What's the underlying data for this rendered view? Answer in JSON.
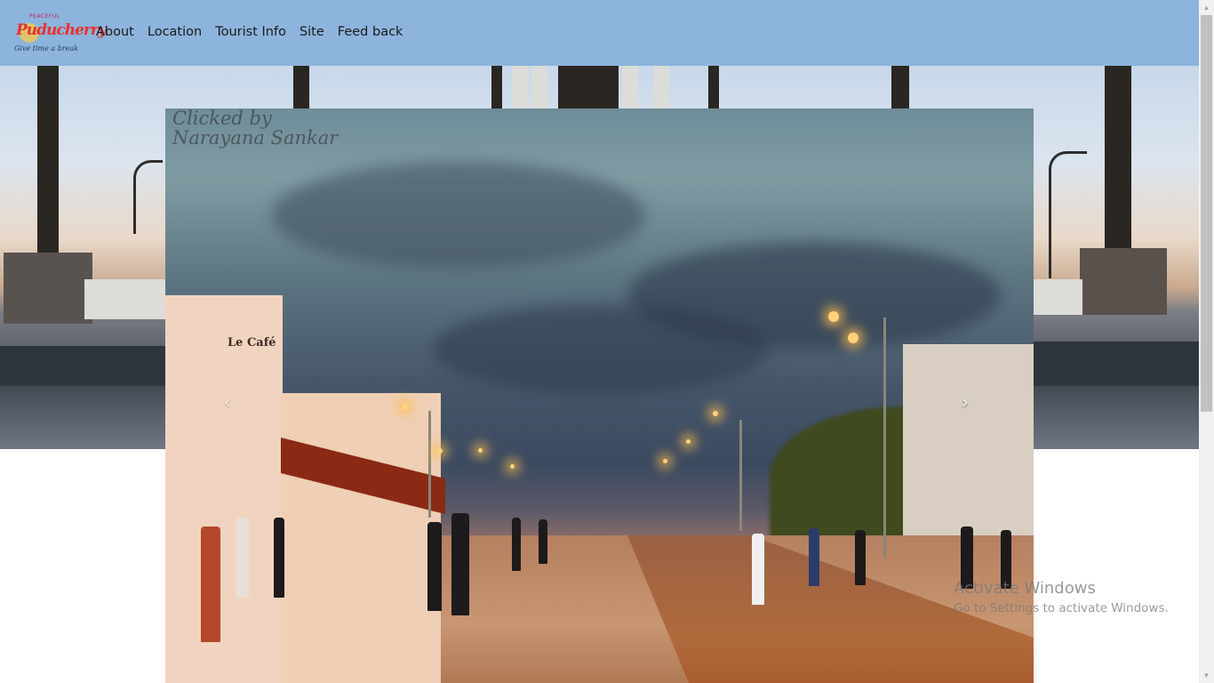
{
  "brand": {
    "tagline_top": "PEACEFUL",
    "name": "Puducherry",
    "slogan": "Give time a break"
  },
  "nav": {
    "items": [
      "About",
      "Location",
      "Tourist Info",
      "Site",
      "Feed back"
    ]
  },
  "carousel": {
    "watermark_line1": "Clicked by",
    "watermark_line2": "Narayana Sankar",
    "cafe_sign": "Le Café",
    "prev_symbol": "‹",
    "next_symbol": "›"
  },
  "os_notice": {
    "title": "Activate Windows",
    "subtitle": "Go to Settings to activate Windows."
  },
  "colors": {
    "navbar": "#8db4dc",
    "link": "#1a1a1a"
  }
}
